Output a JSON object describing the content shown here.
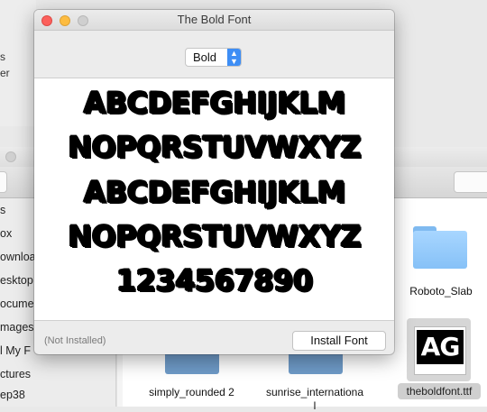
{
  "desktop": {
    "items": [
      "s",
      "er"
    ]
  },
  "finder": {
    "sidebar": {
      "items": [
        "s",
        "ox",
        "ownloa",
        "esktop",
        "ocume",
        "mages",
        "l My F",
        "ctures",
        "ep38"
      ]
    },
    "files": [
      {
        "name": "Roboto_Slab",
        "icon": "folder-icon"
      },
      {
        "name": "simply_rounded 2",
        "icon": "folder-icon"
      },
      {
        "name": "sunrise_internationa",
        "name_line2": "l",
        "icon": "folder-icon"
      },
      {
        "name": "theboldfont.ttf",
        "icon": "font-file-icon",
        "thumbnail_text": "AG",
        "selected": true
      }
    ]
  },
  "font_window": {
    "title": "The Bold Font",
    "style_select": {
      "value": "Bold"
    },
    "preview_lines": [
      "ABCDEFGHIJKLM",
      "NOPQRSTUVWXYZ",
      "ABCDEFGHIJKLM",
      "NOPQRSTUVWXYZ",
      "1234567890"
    ],
    "status": "(Not Installed)",
    "install_button_label": "Install Font",
    "traffic_lights": {
      "close": "#fc605c",
      "minimize": "#fdbc40",
      "zoom": "#cfcfcf"
    },
    "accent": "#3e8ef5"
  }
}
